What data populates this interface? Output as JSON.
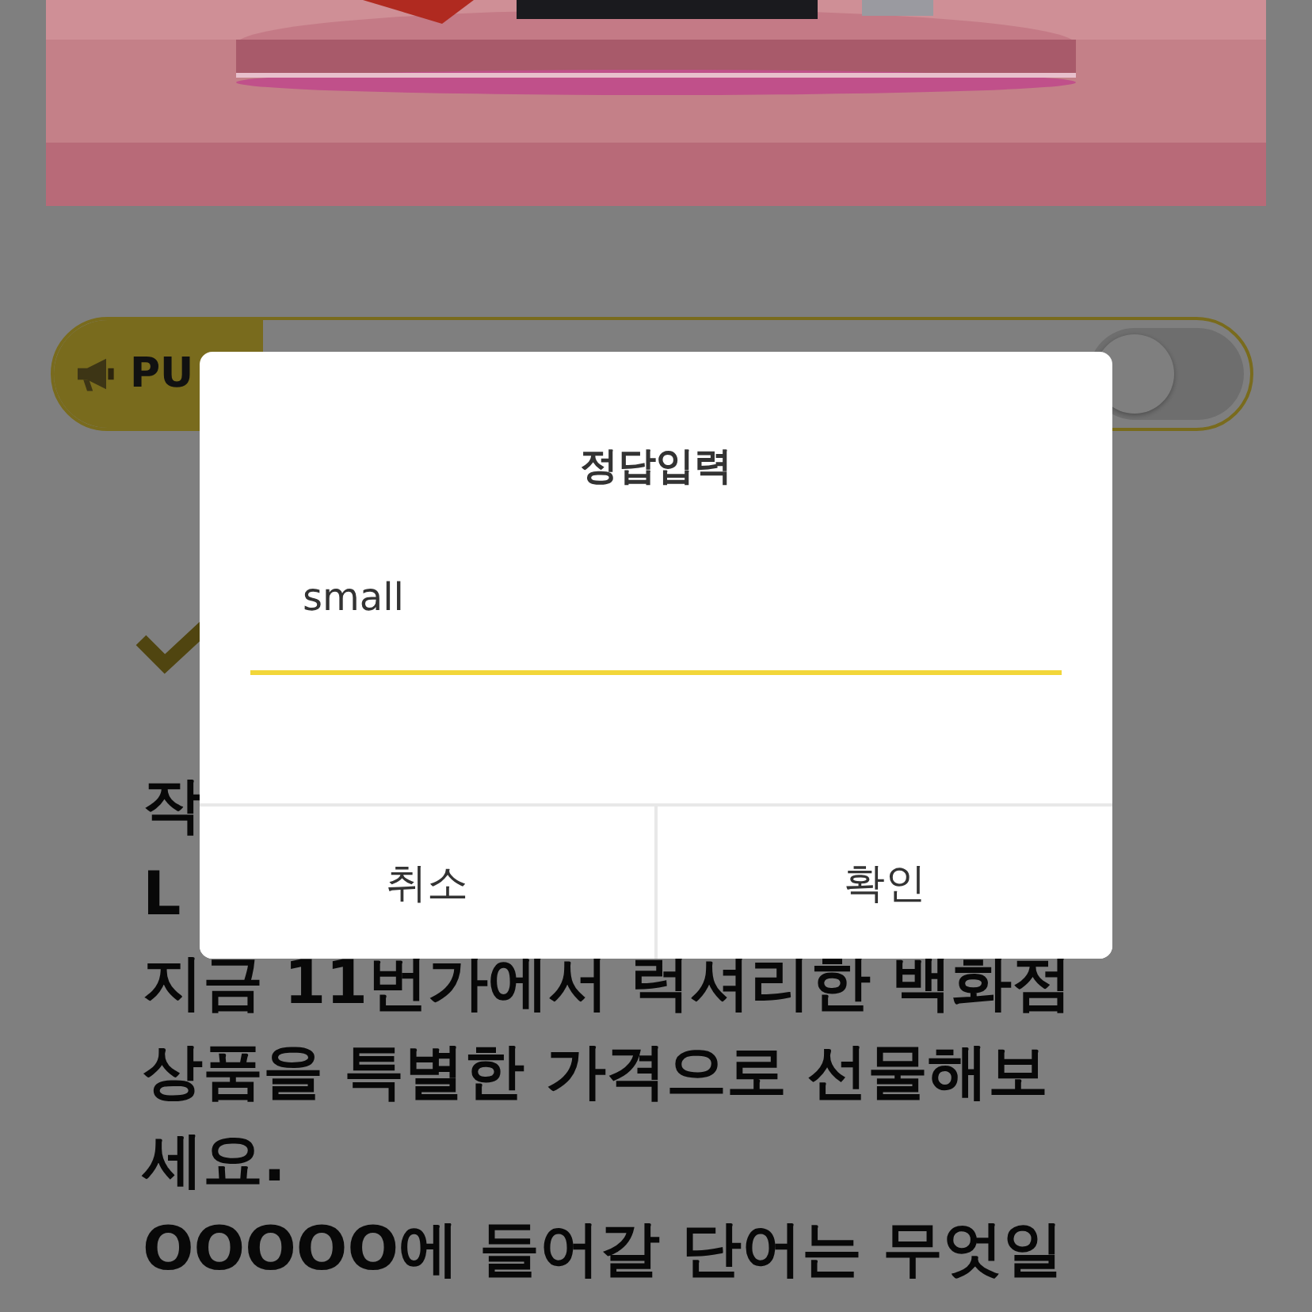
{
  "push_toggle": {
    "label": "PU",
    "on": false
  },
  "question_lines": [
    "작",
    "L",
    "지금 11번가에서 럭셔리한 백화점",
    "상품을 특별한 가격으로 선물해보",
    "세요.",
    "OOOOO에 들어갈 단어는 무엇일"
  ],
  "dialog": {
    "title": "정답입력",
    "answer": "small",
    "buttons": [
      {
        "label": "취소",
        "kind": "cancel"
      },
      {
        "label": "확인",
        "kind": "confirm"
      }
    ]
  }
}
